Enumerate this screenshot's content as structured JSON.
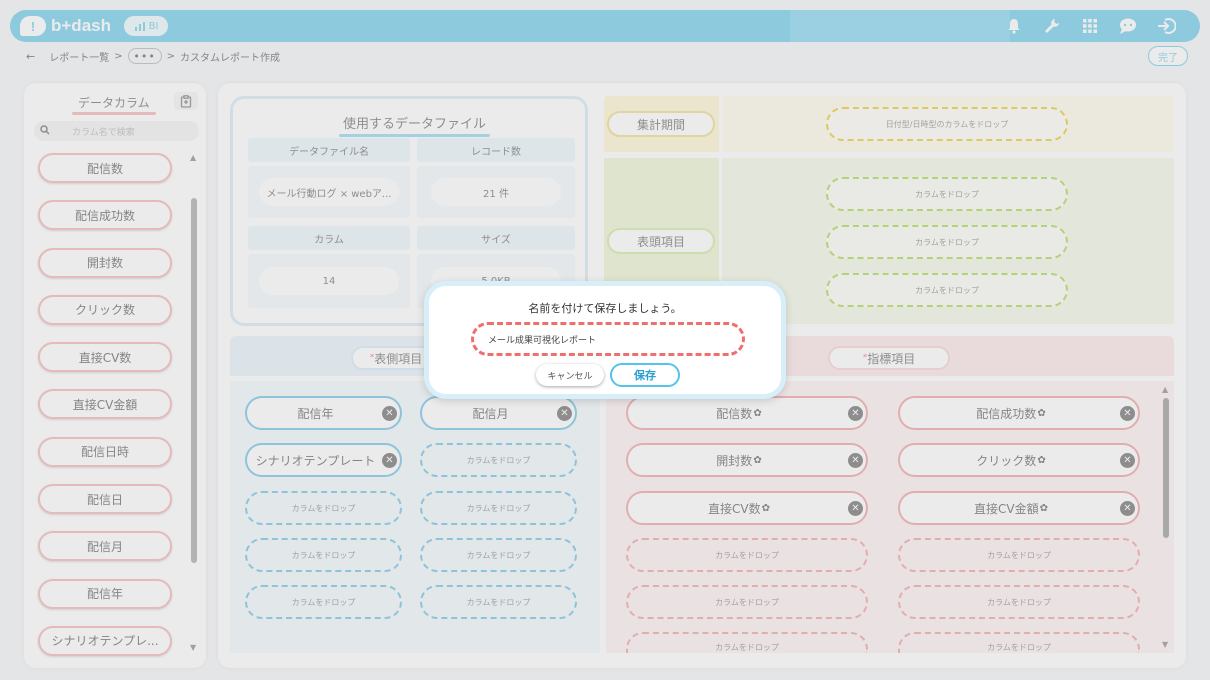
{
  "app": {
    "logo_text": "b+dash",
    "logo_mark": "!",
    "bi_badge": "BI"
  },
  "top_icons": [
    "bell-icon",
    "wrench-icon",
    "grid-icon",
    "chat-icon",
    "logout-icon"
  ],
  "breadcrumb": {
    "back": "←",
    "items": [
      "レポート一覧",
      "カスタムレポート作成"
    ],
    "separator": ">",
    "more": "•••"
  },
  "done_button": "完了",
  "sidebar": {
    "title": "データカラム",
    "search_placeholder": "カラム名で検索",
    "items": [
      "配信数",
      "配信成功数",
      "開封数",
      "クリック数",
      "直接CV数",
      "直接CV金額",
      "配信日時",
      "配信日",
      "配信月",
      "配信年",
      "シナリオテンプレ..."
    ]
  },
  "file_card": {
    "title": "使用するデータファイル",
    "labels": {
      "file_name": "データファイル名",
      "record_count": "レコード数",
      "columns": "カラム",
      "size": "サイズ"
    },
    "values": {
      "file_name": "メール行動ログ × webア...",
      "record_count": "21 件",
      "columns": "14",
      "size": "5.0KB"
    }
  },
  "period": {
    "label": "集計期間",
    "drop": "日付型/日時型のカラムをドロップ"
  },
  "header_items": {
    "label": "表頭項目",
    "drops": [
      "カラムをドロップ",
      "カラムをドロップ",
      "カラムをドロップ"
    ]
  },
  "row_items": {
    "label": "表側項目",
    "required_mark": "*",
    "filled": [
      "配信年",
      "配信月",
      "シナリオテンプレート"
    ],
    "drop": "カラムをドロップ"
  },
  "metric_items": {
    "label": "指標項目",
    "required_mark": "*",
    "filled": [
      "配信数",
      "配信成功数",
      "開封数",
      "クリック数",
      "直接CV数",
      "直接CV金額"
    ],
    "drop": "カラムをドロップ",
    "gear": "✿"
  },
  "dialog": {
    "title": "名前を付けて保存しましょう。",
    "input_value": "メール成果可視化レポート",
    "cancel": "キャンセル",
    "save": "保存"
  },
  "colors": {
    "brand": "#56c3e8",
    "metric": "#ee8f8f",
    "row": "#56b8e0",
    "header": "#9bd12f",
    "period": "#e8c000"
  }
}
